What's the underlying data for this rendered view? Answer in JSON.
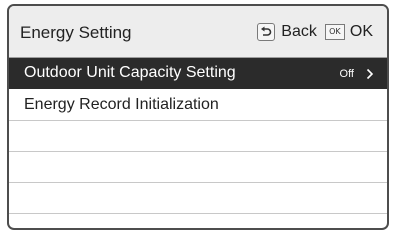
{
  "header": {
    "title": "Energy Setting",
    "back_label": "Back",
    "ok_icon_text": "OK",
    "ok_label": "OK",
    "back_icon": "return-arrow-icon"
  },
  "menu": {
    "items": [
      {
        "label": "Outdoor Unit Capacity Setting",
        "value": "Off",
        "selected": true,
        "icon": "chevron-right-icon"
      },
      {
        "label": "Energy Record Initialization",
        "value": "",
        "selected": false
      },
      {
        "label": "",
        "value": "",
        "selected": false
      },
      {
        "label": "",
        "value": "",
        "selected": false
      },
      {
        "label": "",
        "value": "",
        "selected": false
      }
    ]
  },
  "colors": {
    "header_bg": "#ededed",
    "selected_bg": "#2b2b2b",
    "selected_text": "#ffffff",
    "text": "#222222",
    "border": "#4d4d4d"
  }
}
